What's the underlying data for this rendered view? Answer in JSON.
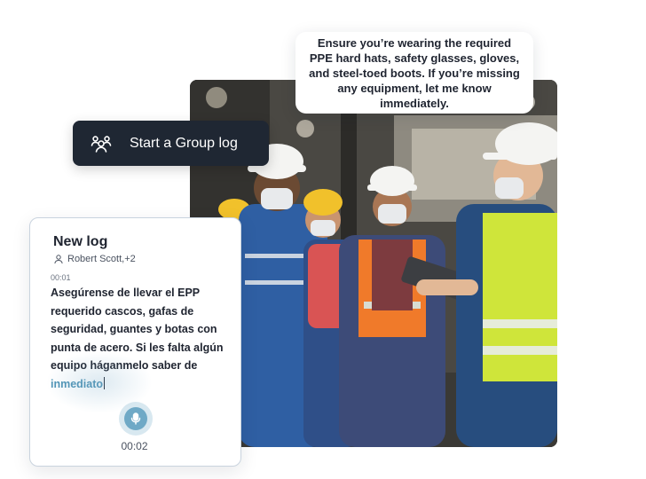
{
  "bubble": {
    "text": "Ensure you’re wearing the required PPE hard hats, safety glasses, gloves, and steel-toed boots. If you’re missing any equipment, let me know immediately."
  },
  "group_button": {
    "label": "Start a Group log",
    "icon": "group-icon"
  },
  "log_card": {
    "title": "New log",
    "participants": "Robert Scott,+2",
    "timestamp": "00:01",
    "transcript_main": "Asegúrense de llevar el EPP requerido cascos, gafas de seguridad, guantes y botas con punta de acero. Si les falta algún equipo háganmelo saber de ",
    "transcript_live": "inmediato",
    "timer": "00:02",
    "mic_icon": "microphone-icon"
  },
  "colors": {
    "dark_button": "#1f2733",
    "accent": "#4f93b5",
    "card_border": "#c9d3de"
  }
}
